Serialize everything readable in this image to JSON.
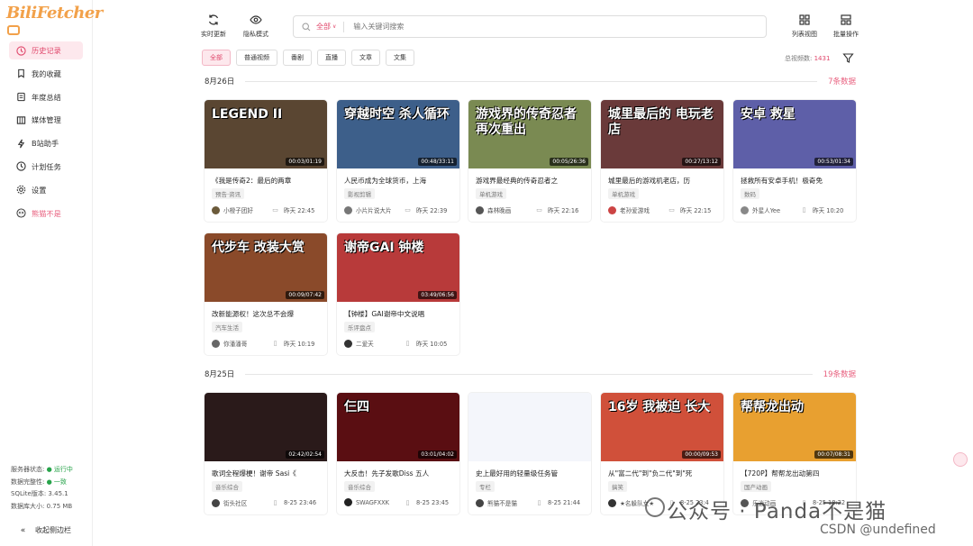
{
  "app": {
    "logo": "BiliFetcher"
  },
  "sidebar": {
    "items": [
      {
        "label": "历史记录",
        "icon": "clock-icon"
      },
      {
        "label": "我的收藏",
        "icon": "bookmark-icon"
      },
      {
        "label": "年度总结",
        "icon": "document-icon"
      },
      {
        "label": "媒体管理",
        "icon": "columns-icon"
      },
      {
        "label": "B站助手",
        "icon": "bolt-icon"
      },
      {
        "label": "计划任务",
        "icon": "clock-icon"
      },
      {
        "label": "设置",
        "icon": "gear-icon"
      },
      {
        "label": "熊猫不是",
        "icon": "panda-avatar-icon"
      }
    ],
    "status": {
      "server_label": "服务器状态:",
      "server_value": "● 运行中",
      "data_label": "数据完整性:",
      "data_value": "● 一致",
      "sqlite_label": "SQLite版本: 3.45.1",
      "dbsize_label": "数据库大小: 0.75 MB"
    },
    "collapse_label": "收起侧边栏"
  },
  "toolbar": {
    "realtime_label": "实时更新",
    "privacy_label": "隐私模式",
    "list_view_label": "列表视图",
    "batch_label": "批量操作"
  },
  "search": {
    "scope": "全部",
    "placeholder": "输入关键词搜索"
  },
  "filters": [
    "全部",
    "普通视频",
    "番剧",
    "直播",
    "文章",
    "文集"
  ],
  "total": {
    "label": "总视频数:",
    "value": "1431"
  },
  "groups": [
    {
      "date": "8月26日",
      "count": "7条数据",
      "cards": [
        {
          "thumb_text": "LEGEND II",
          "duration": "00:03/01:19",
          "title": "《我是传奇2：最后的两章",
          "tag": "预告·资讯",
          "author": "小橙子团好",
          "time": "昨天 22:45",
          "device": "pc",
          "bg": "#5a4632",
          "avatar_color": "#6b5a3a"
        },
        {
          "thumb_text": "穿越时空 杀人循环",
          "duration": "00:48/33:11",
          "title": "人民币成为全球货币，上海",
          "tag": "影视剪辑",
          "author": "小片片说大片",
          "time": "昨天 22:39",
          "device": "pc",
          "bg": "#3d5f8a",
          "avatar_color": "#777"
        },
        {
          "thumb_text": "游戏界的传奇忍者 再次重出",
          "duration": "00:05/26:36",
          "title": "游戏界最经典的传奇忍者之",
          "tag": "单机游戏",
          "author": "森林晚画",
          "time": "昨天 22:16",
          "device": "pc",
          "bg": "#7a8a52",
          "avatar_color": "#555"
        },
        {
          "thumb_text": "城里最后的 电玩老店",
          "duration": "00:27/13:12",
          "title": "城里最后的游戏机老店，历",
          "tag": "单机游戏",
          "author": "老孙爱游戏",
          "time": "昨天 22:15",
          "device": "pc",
          "bg": "#6a3a3a",
          "avatar_color": "#c44"
        },
        {
          "thumb_text": "安卓 救星",
          "duration": "00:53/01:34",
          "title": "拯救所有安卓手机！极奇免",
          "tag": "数码",
          "author": "外星人Yee",
          "time": "昨天 10:20",
          "device": "phone",
          "bg": "#5e5fa8",
          "avatar_color": "#888"
        }
      ]
    },
    {
      "date": "",
      "count": "",
      "cards": [
        {
          "thumb_text": "代步车 改装大赏",
          "duration": "00:09/07:42",
          "title": "改新能源权！这次总不会爆",
          "tag": "汽车生活",
          "author": "你潘潘哥",
          "time": "昨天 10:19",
          "device": "phone",
          "bg": "#8a4a2a",
          "avatar_color": "#666"
        },
        {
          "thumb_text": "谢帝GAI 钟楼",
          "duration": "03:49/06:56",
          "title": "【钟楼】GAI谢帝中文说唱",
          "tag": "乐评盘点",
          "author": "二爱天",
          "time": "昨天 10:05",
          "device": "phone",
          "bg": "#b83a3a",
          "avatar_color": "#333"
        }
      ]
    },
    {
      "date": "8月25日",
      "count": "19条数据",
      "cards": [
        {
          "thumb_text": "",
          "duration": "02:42/02:54",
          "title": "歌词全程爆梗！谢帝 Sasi《",
          "tag": "音乐综合",
          "author": "街头社区",
          "time": "8-25 23:46",
          "device": "phone",
          "bg": "#2a1a1a",
          "avatar_color": "#444"
        },
        {
          "thumb_text": "仨四",
          "duration": "03:01/04:02",
          "title": "大反击！先子发歌Diss 五人",
          "tag": "音乐综合",
          "author": "SWAGFXXK",
          "time": "8-25 23:45",
          "device": "phone",
          "bg": "#5a0e12",
          "avatar_color": "#222"
        },
        {
          "thumb_text": "",
          "duration": "",
          "title": "史上最好用的轻量级任务管",
          "tag": "专栏",
          "author": "熊猫不是猫",
          "time": "8-25 21:44",
          "device": "phone",
          "bg": "#f4f6fb",
          "avatar_color": "#444"
        },
        {
          "thumb_text": "16岁 我被迫 长大",
          "duration": "00:00/09:53",
          "title": "从\"富二代\"到\"负二代\"到\"死",
          "tag": "搞笑",
          "author": "★名躲队女★",
          "time": "8-25 23:4",
          "device": "phone",
          "bg": "#d0503a",
          "avatar_color": "#333"
        },
        {
          "thumb_text": "帮帮龙出动",
          "duration": "00:07/08:31",
          "title": "【720P】帮帮龙出动第四",
          "tag": "国产动画",
          "author": "乐逍动画",
          "time": "8-25 18:22",
          "device": "phone",
          "bg": "#e8a030",
          "avatar_color": "#555"
        }
      ]
    }
  ],
  "watermark": {
    "main": "公众号 · Panda不是猫",
    "sub": "CSDN @undefined"
  }
}
